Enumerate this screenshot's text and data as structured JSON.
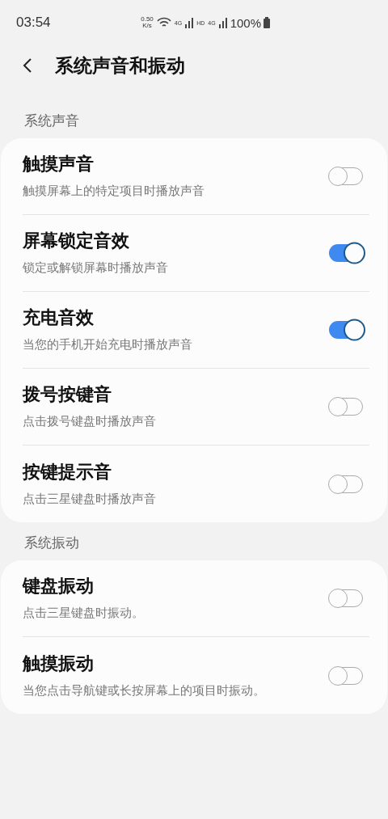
{
  "status_bar": {
    "time": "03:54",
    "speed_value": "0.50",
    "speed_unit": "K/s",
    "network_1": "4G",
    "hd": "HD",
    "network_2": "4G",
    "battery": "100%"
  },
  "header": {
    "title": "系统声音和振动"
  },
  "sections": [
    {
      "title": "系统声音",
      "items": [
        {
          "title": "触摸声音",
          "subtitle": "触摸屏幕上的特定项目时播放声音",
          "on": false
        },
        {
          "title": "屏幕锁定音效",
          "subtitle": "锁定或解锁屏幕时播放声音",
          "on": true
        },
        {
          "title": "充电音效",
          "subtitle": "当您的手机开始充电时播放声音",
          "on": true
        },
        {
          "title": "拨号按键音",
          "subtitle": "点击拨号键盘时播放声音",
          "on": false
        },
        {
          "title": "按键提示音",
          "subtitle": "点击三星键盘时播放声音",
          "on": false
        }
      ]
    },
    {
      "title": "系统振动",
      "items": [
        {
          "title": "键盘振动",
          "subtitle": "点击三星键盘时振动。",
          "on": false
        },
        {
          "title": "触摸振动",
          "subtitle": "当您点击导航键或长按屏幕上的项目时振动。",
          "on": false
        }
      ]
    }
  ]
}
